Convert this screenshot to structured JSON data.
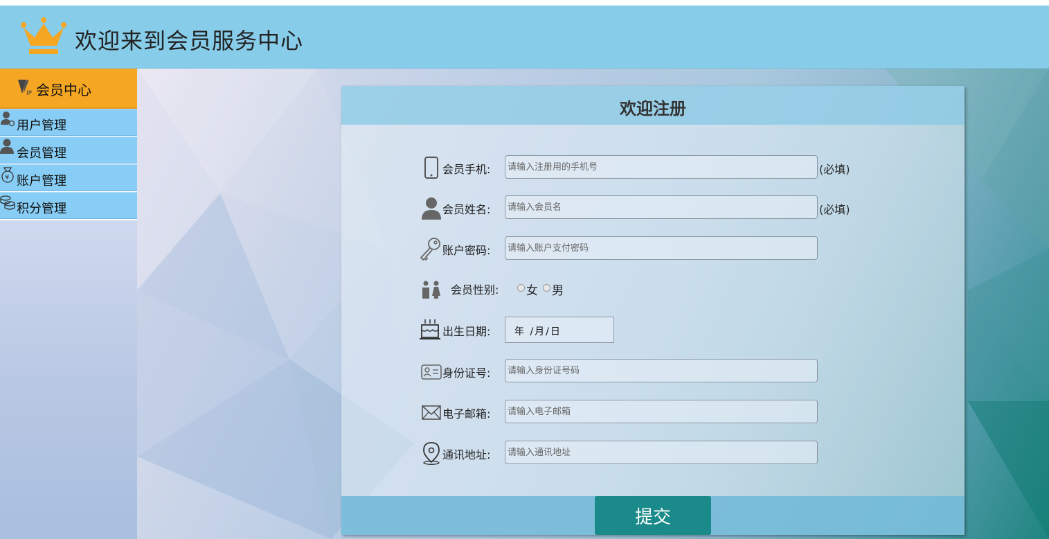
{
  "header": {
    "title": "欢迎来到会员服务中心",
    "accent": "#87cdea",
    "crown_color": "#f5a623"
  },
  "sidebar": {
    "heading": "会员中心",
    "items": [
      {
        "label": "用户管理",
        "icon": "user-gear-icon"
      },
      {
        "label": "会员管理",
        "icon": "user-icon"
      },
      {
        "label": "账户管理",
        "icon": "money-bag-icon"
      },
      {
        "label": "积分管理",
        "icon": "coins-icon"
      }
    ]
  },
  "form": {
    "title": "欢迎注册",
    "fields": {
      "phone": {
        "label": "会员手机:",
        "placeholder": "请输入注册用的手机号",
        "required": "(必填)"
      },
      "name": {
        "label": "会员姓名:",
        "placeholder": "请输入会员名",
        "required": "(必填)"
      },
      "password": {
        "label": "账户密码:",
        "placeholder": "请输入账户支付密码"
      },
      "gender": {
        "label": "会员性别:",
        "options": [
          "女",
          "男"
        ]
      },
      "birthday": {
        "label": "出生日期:",
        "value": "年 /月/日"
      },
      "idcard": {
        "label": "身份证号:",
        "placeholder": "请输入身份证号码"
      },
      "email": {
        "label": "电子邮箱:",
        "placeholder": "请输入电子邮箱"
      },
      "address": {
        "label": "通讯地址:",
        "placeholder": "请输入通讯地址"
      }
    },
    "submit": "提交",
    "submit_color": "#1a8a8a"
  }
}
